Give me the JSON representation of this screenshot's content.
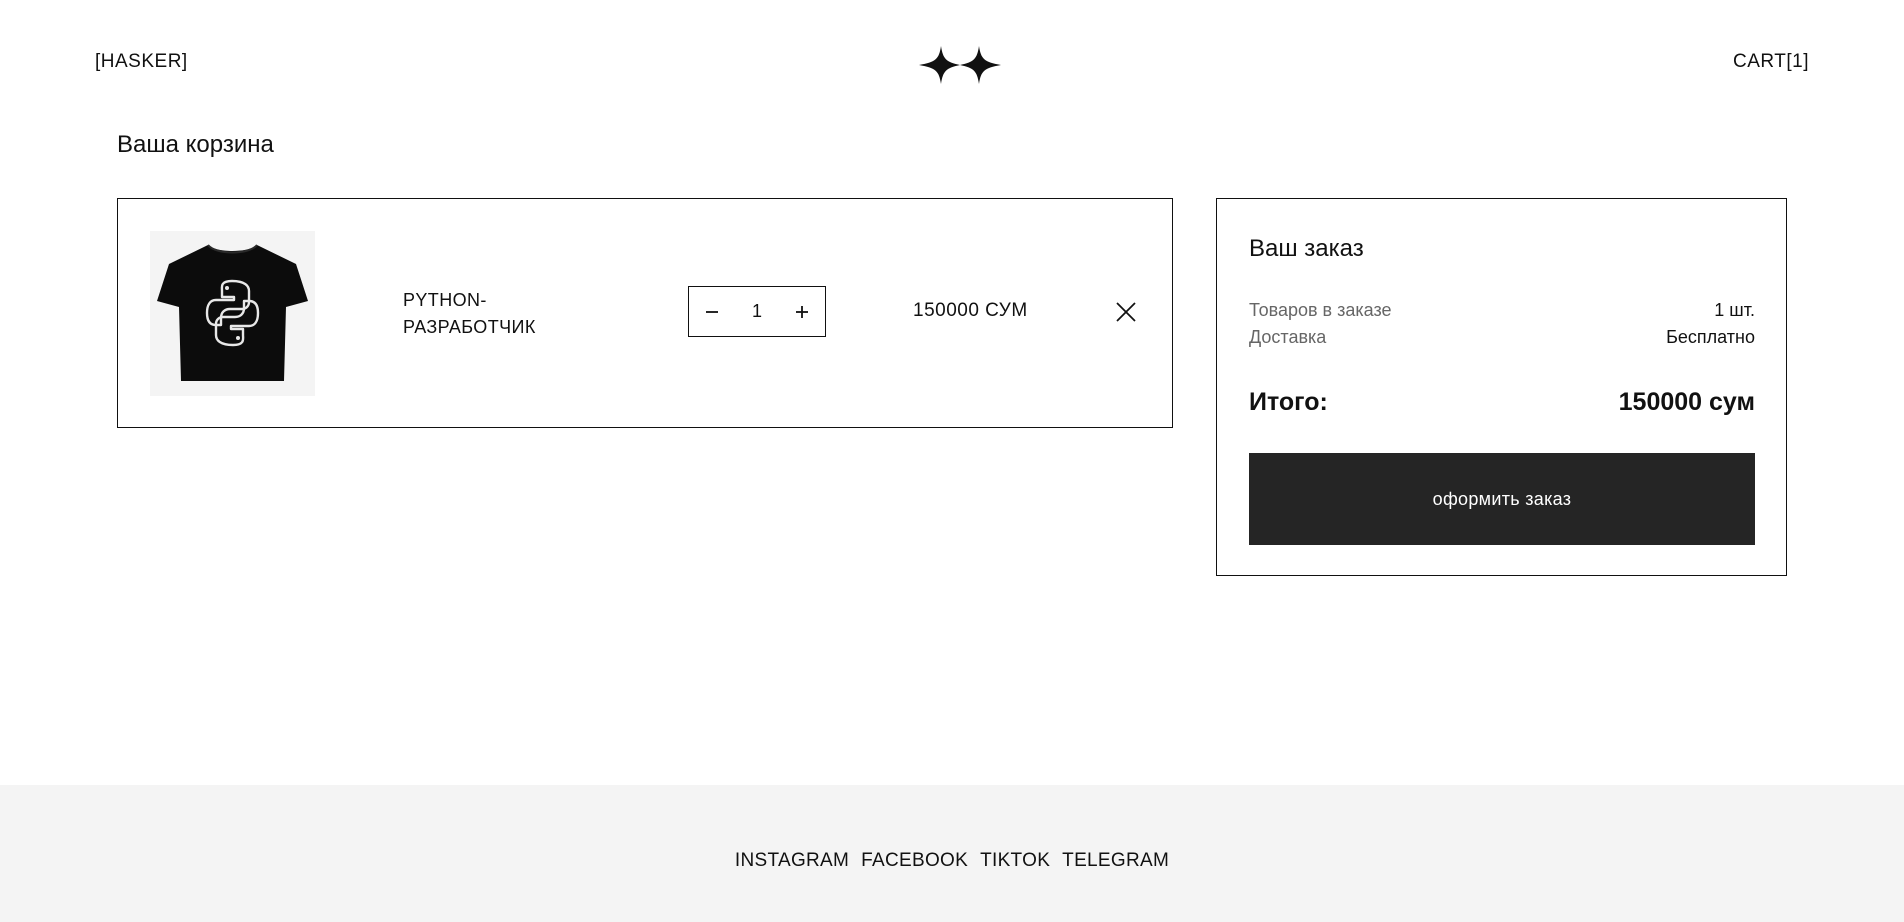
{
  "header": {
    "brand": "[HASKER]",
    "cart_label": "CART[1]"
  },
  "page": {
    "title": "Ваша корзина"
  },
  "cart": {
    "items": [
      {
        "name": "PYTHON-РАЗРАБОТЧИК",
        "quantity": "1",
        "price": "150000 СУМ",
        "image_icon": "python-logo-tshirt"
      }
    ]
  },
  "summary": {
    "title": "Ваш заказ",
    "items_label": "Товаров в заказе",
    "items_value": "1 шт.",
    "delivery_label": "Доставка",
    "delivery_value": "Бесплатно",
    "total_label": "Итого:",
    "total_value": "150000 сум",
    "checkout_label": "оформить заказ"
  },
  "footer": {
    "links": [
      "INSTAGRAM",
      "FACEBOOK",
      "TIKTOK",
      "TELEGRAM"
    ]
  },
  "colors": {
    "primary_text": "#111111",
    "muted_text": "#666666",
    "button_bg": "#252525",
    "footer_bg": "#f4f4f4",
    "image_bg": "#f4f4f4"
  },
  "icons": {
    "logo": "double-sparkle-icon",
    "remove": "close-icon",
    "decrement": "minus-icon",
    "increment": "plus-icon"
  }
}
